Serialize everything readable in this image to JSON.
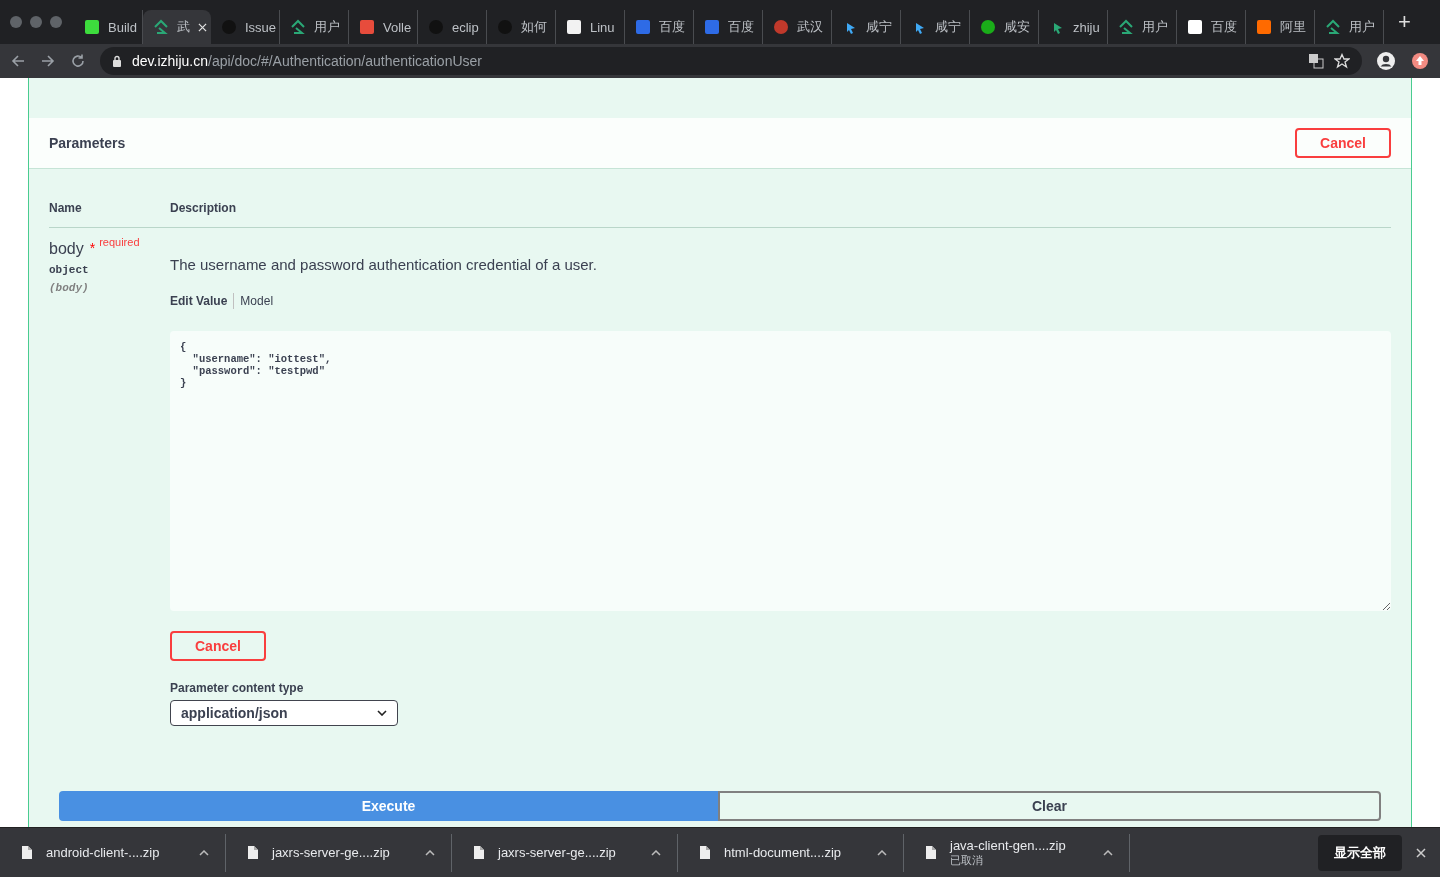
{
  "browser": {
    "tabs": [
      {
        "title": "Build",
        "selected": false,
        "kind": "square",
        "color": "#3ddc3d"
      },
      {
        "title": "武",
        "selected": true,
        "kind": "house",
        "color": "#2aa876"
      },
      {
        "title": "Issue",
        "selected": false,
        "kind": "circle",
        "color": "#111111"
      },
      {
        "title": "用户",
        "selected": false,
        "kind": "house",
        "color": "#2aa876"
      },
      {
        "title": "Volle",
        "selected": false,
        "kind": "square",
        "color": "#e74c3c"
      },
      {
        "title": "eclip",
        "selected": false,
        "kind": "circle",
        "color": "#111111"
      },
      {
        "title": "如何",
        "selected": false,
        "kind": "circle",
        "color": "#111111"
      },
      {
        "title": "Linu",
        "selected": false,
        "kind": "square",
        "color": "#f2f2f2"
      },
      {
        "title": "百度",
        "selected": false,
        "kind": "square",
        "color": "#2e6be6"
      },
      {
        "title": "百度",
        "selected": false,
        "kind": "square",
        "color": "#2e6be6"
      },
      {
        "title": "武汉",
        "selected": false,
        "kind": "circle",
        "color": "#c0392b"
      },
      {
        "title": "咸宁",
        "selected": false,
        "kind": "cursor",
        "color": "#3fa9f5"
      },
      {
        "title": "咸宁",
        "selected": false,
        "kind": "cursor",
        "color": "#3fa9f5"
      },
      {
        "title": "咸安",
        "selected": false,
        "kind": "circle",
        "color": "#1aad19"
      },
      {
        "title": "zhiju",
        "selected": false,
        "kind": "cursor",
        "color": "#2aa876"
      },
      {
        "title": "用户",
        "selected": false,
        "kind": "house",
        "color": "#2aa876"
      },
      {
        "title": "百度",
        "selected": false,
        "kind": "square",
        "color": "#ffffff"
      },
      {
        "title": "阿里",
        "selected": false,
        "kind": "square",
        "color": "#ff6a00"
      },
      {
        "title": "用户",
        "selected": false,
        "kind": "house",
        "color": "#2aa876"
      }
    ],
    "new_tab": "+",
    "url": {
      "host": "dev.izhiju.cn",
      "path": "/api/doc/#/Authentication/authenticationUser"
    }
  },
  "operation": {
    "parameters_title": "Parameters",
    "cancel_top": "Cancel",
    "columns": [
      "Name",
      "Description"
    ],
    "param": {
      "name": "body",
      "required_mark": "*",
      "required": "required",
      "type": "object",
      "location": "(body)",
      "description": "The username and password authentication credential of a user.",
      "tabs": [
        {
          "label": "Edit Value",
          "selected": true
        },
        {
          "label": "Model",
          "selected": false
        }
      ],
      "value": "{\n  \"username\": \"iottest\",\n  \"password\": \"testpwd\"\n}",
      "cancel": "Cancel",
      "content_type_label": "Parameter content type",
      "content_type": "application/json"
    },
    "execute": "Execute",
    "clear": "Clear"
  },
  "downloads": {
    "items": [
      {
        "name": "android-client-....zip"
      },
      {
        "name": "jaxrs-server-ge....zip"
      },
      {
        "name": "jaxrs-server-ge....zip"
      },
      {
        "name": "html-document....zip"
      },
      {
        "name": "java-client-gen....zip",
        "status": "已取消"
      }
    ],
    "show_all": "显示全部"
  }
}
